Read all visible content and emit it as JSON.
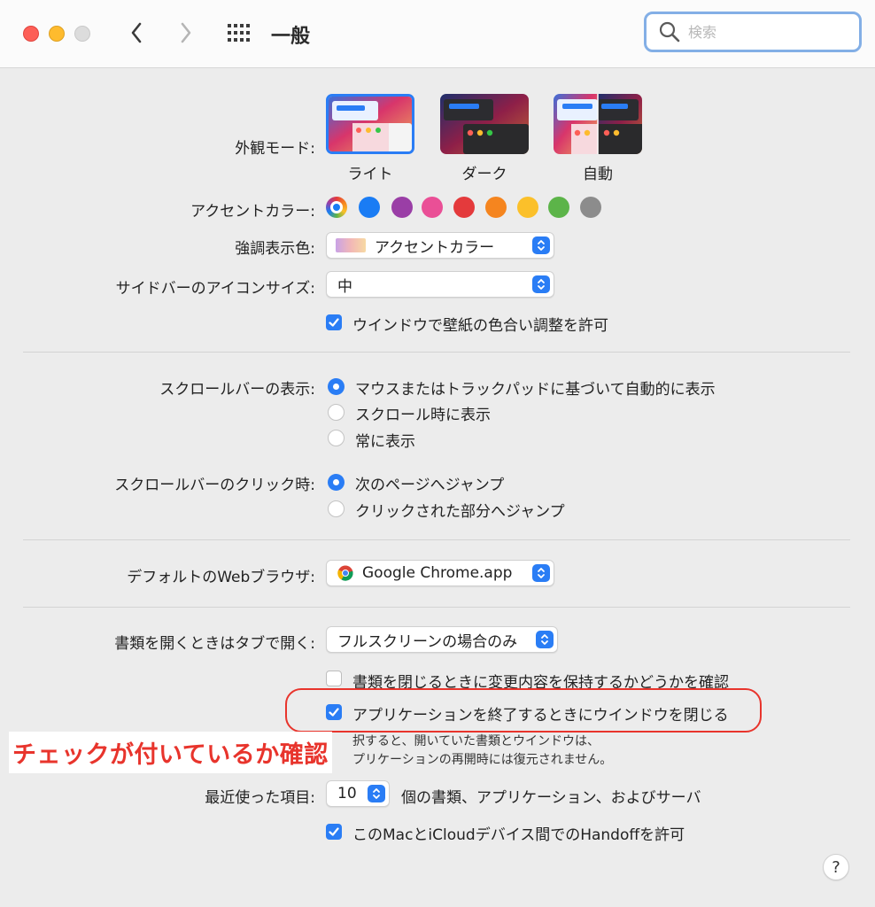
{
  "window": {
    "title": "一般",
    "search_placeholder": "検索"
  },
  "appearance": {
    "label": "外観モード:",
    "options": [
      {
        "name": "ライト",
        "selected": true
      },
      {
        "name": "ダーク",
        "selected": false
      },
      {
        "name": "自動",
        "selected": false
      }
    ]
  },
  "accent": {
    "label": "アクセントカラー:",
    "colors": [
      "multicolor",
      "#1a7cf4",
      "#9a3ea6",
      "#ea4f96",
      "#e43a3c",
      "#f5851f",
      "#fbc02a",
      "#5cb449",
      "#8c8c8c"
    ]
  },
  "highlight": {
    "label": "強調表示色:",
    "value": "アクセントカラー"
  },
  "sidebar_icon_size": {
    "label": "サイドバーのアイコンサイズ:",
    "value": "中"
  },
  "wallpaper_tint": {
    "label": "ウインドウで壁紙の色合い調整を許可",
    "checked": true
  },
  "scroll_bars": {
    "label": "スクロールバーの表示:",
    "options": [
      {
        "label": "マウスまたはトラックパッドに基づいて自動的に表示",
        "selected": true
      },
      {
        "label": "スクロール時に表示",
        "selected": false
      },
      {
        "label": "常に表示",
        "selected": false
      }
    ]
  },
  "scroll_click": {
    "label": "スクロールバーのクリック時:",
    "options": [
      {
        "label": "次のページへジャンプ",
        "selected": true
      },
      {
        "label": "クリックされた部分へジャンプ",
        "selected": false
      }
    ]
  },
  "default_browser": {
    "label": "デフォルトのWebブラウザ:",
    "value": "Google Chrome.app"
  },
  "prefer_tabs": {
    "label": "書類を開くときはタブで開く:",
    "value": "フルスクリーンの場合のみ"
  },
  "ask_keep_changes": {
    "label": "書類を閉じるときに変更内容を保持するかどうかを確認",
    "checked": false
  },
  "close_windows": {
    "label": "アプリケーションを終了するときにウインドウを閉じる",
    "checked": true,
    "note_line1": "択すると、開いていた書類とウインドウは、",
    "note_line2": "プリケーションの再開時には復元されません。"
  },
  "annotation": {
    "text": "チェックが付いているか確認",
    "color": "#e8342c"
  },
  "recent_items": {
    "label": "最近使った項目:",
    "value": "10",
    "suffix": "個の書類、アプリケーション、およびサーバ"
  },
  "handoff": {
    "label": "このMacとiCloudデバイス間でのHandoffを許可",
    "checked": true
  },
  "help": {
    "label": "?"
  }
}
